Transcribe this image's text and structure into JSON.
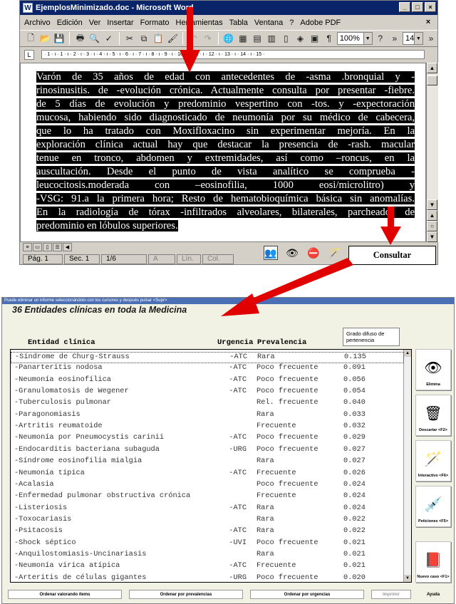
{
  "word": {
    "title": "EjemplosMinimizado.doc - Microsoft Word",
    "menu": [
      "Archivo",
      "Edición",
      "Ver",
      "Insertar",
      "Formato",
      "Herramientas",
      "Tabla",
      "Ventana",
      "?",
      "Adobe PDF"
    ],
    "zoom": "100%",
    "font_size": "14",
    "ruler_text": "· 1 · ı · 1 · ı · 2 · ı · 3 · ı · 4 · ı · 5 · ı · 6 · ı · 7 · ı · 8 · ı · 9 · ı · 10 · ı · 11 · ı · 12 · ı · 13 · ı · 14 · ı · 15 ·",
    "document_lines": [
      "Varón de 35 años de edad   con antecedentes de -asma .bronquial y -",
      "rinosinusitis. de -evolución crónica. Actualmente consulta por presentar -fiebre.",
      "de 5 días de evolución y predominio vespertino con -tos. y -expectoración",
      "mucosa, habiendo sido diagnosticado de neumonía por su médico de cabecera,",
      "que lo ha tratado con Moxifloxacino sin experimentar mejoría. En la",
      "exploración clínica actual  hay que destacar la presencia de -rash. macular",
      "tenue en tronco, abdomen y extremidades, así como –roncus, en la",
      "auscultación. Desde el punto de vista analítico se comprueba   -",
      "leucocitosis.moderada con –eosinofilia, 1000 eosi/microlitro) y",
      "-VSG: 91.a la primera hora; Resto de hematobioquímica básica sin anomalías.",
      "En la radiología de tórax -infiltrados alveolares, bilaterales, parcheados de",
      "predominio en lóbulos superiores."
    ],
    "status": {
      "page": "Pág. 1",
      "section": "Sec. 1",
      "pages": "1/6",
      "at": "A",
      "line": "Lín.",
      "col": "Col."
    },
    "consultar_label": "Consultar"
  },
  "results": {
    "hint": "Puede eliminar un informe seleccionándolo con los cursores y después pulsar <Supr>",
    "title": "36 Entidades clínicas en toda la Medicina",
    "grado_label": "Grado difuso de pertenencia",
    "headers": {
      "entity": "Entidad clínica",
      "urgency": "Urgencia",
      "prevalence": "Prevalencia"
    },
    "rows": [
      {
        "name": "-Síndrome de Churg-Strauss",
        "urg": "-ATC",
        "prev": "Rara",
        "grade": "0.135"
      },
      {
        "name": "-Panarteritis nodosa",
        "urg": "-ATC",
        "prev": "Poco frecuente",
        "grade": "0.091"
      },
      {
        "name": "-Neumonía eosinofílica",
        "urg": "-ATC",
        "prev": "Poco frecuente",
        "grade": "0.056"
      },
      {
        "name": "-Granulomatosis de Wegener",
        "urg": "-ATC",
        "prev": "Poco frecuente",
        "grade": "0.054"
      },
      {
        "name": "-Tuberculosis pulmonar",
        "urg": "",
        "prev": "Rel. frecuente",
        "grade": "0.040"
      },
      {
        "name": "-Paragonomiasis",
        "urg": "",
        "prev": "Rara",
        "grade": "0.033"
      },
      {
        "name": "-Artritis reumatoide",
        "urg": "",
        "prev": "Frecuente",
        "grade": "0.032"
      },
      {
        "name": "-Neumonía por Pneumocystis carinii",
        "urg": "-ATC",
        "prev": "Poco frecuente",
        "grade": "0.029"
      },
      {
        "name": "-Endocarditis bacteriana subaguda",
        "urg": "-URG",
        "prev": "Poco frecuente",
        "grade": "0.027"
      },
      {
        "name": "-Síndrome eosinofilia mialgia",
        "urg": "",
        "prev": "Rara",
        "grade": "0.027"
      },
      {
        "name": "-Neumonía típica",
        "urg": "-ATC",
        "prev": "Frecuente",
        "grade": "0.026"
      },
      {
        "name": "-Acalasia",
        "urg": "",
        "prev": "Poco frecuente",
        "grade": "0.024"
      },
      {
        "name": "-Enfermedad pulmonar obstructiva crónica",
        "urg": "",
        "prev": "Frecuente",
        "grade": "0.024"
      },
      {
        "name": "-Listeriosis",
        "urg": "-ATC",
        "prev": "Rara",
        "grade": "0.024"
      },
      {
        "name": "-Toxocariasis",
        "urg": "",
        "prev": "Rara",
        "grade": "0.022"
      },
      {
        "name": "-Psitacosis",
        "urg": "-ATC",
        "prev": "Rara",
        "grade": "0.022"
      },
      {
        "name": "-Shock séptico",
        "urg": "-UVI",
        "prev": "Poco frecuente",
        "grade": "0.021"
      },
      {
        "name": "-Anquilostomiasis-Uncinariasis",
        "urg": "",
        "prev": "Rara",
        "grade": "0.021"
      },
      {
        "name": "-Neumonía vírica atípica",
        "urg": "-ATC",
        "prev": "Frecuente",
        "grade": "0.021"
      },
      {
        "name": "-Arteritis de células gigantes",
        "urg": "-URG",
        "prev": "Poco frecuente",
        "grade": "0.020"
      }
    ],
    "side_buttons": [
      "Elimina",
      "Descartar <F2>",
      "Interactivo <F6>",
      "Peticiones <F5>",
      "Nuevo caso <F1>"
    ],
    "bottom_buttons": [
      "Ordenar valorando ítems",
      "Ordenar por prevalencias",
      "Ordenar por urgencias",
      "Imprimir",
      "Ayuda"
    ]
  }
}
